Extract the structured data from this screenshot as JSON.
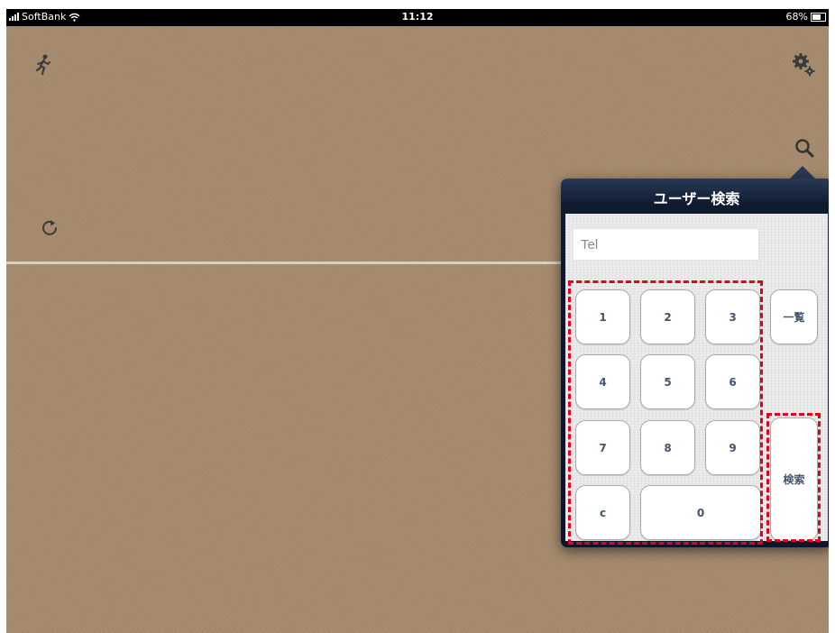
{
  "status_bar": {
    "carrier": "SoftBank",
    "time": "11:12",
    "battery": "68%"
  },
  "toolbar": {
    "runner_icon": "runner-icon",
    "settings_icon": "gear-icon",
    "search_icon": "search-icon",
    "refresh_icon": "refresh-icon"
  },
  "popover": {
    "title": "ユーザー検索",
    "tel_placeholder": "Tel",
    "keys": {
      "k1": "1",
      "k2": "2",
      "k3": "3",
      "k4": "4",
      "k5": "5",
      "k6": "6",
      "k7": "7",
      "k8": "8",
      "k9": "9",
      "clear": "c",
      "k0": "0"
    },
    "list_label": "一覧",
    "search_label": "検索"
  },
  "colors": {
    "background": "#a58a6d",
    "popover_header": "#0e1a2e",
    "key_text": "#44556d",
    "highlight": "#e4001c"
  }
}
